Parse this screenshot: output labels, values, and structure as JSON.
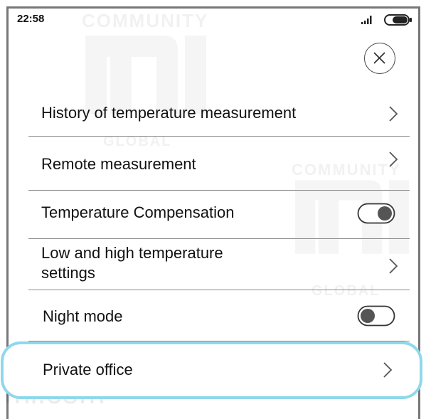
{
  "status_bar": {
    "time": "22:58",
    "signal_icon": "signal-bars-icon",
    "battery_icon": "battery-icon"
  },
  "header": {
    "close_icon": "close-circle-icon"
  },
  "menu": {
    "items": [
      {
        "label": "History of temperature measurement",
        "control": "chevron-right-icon"
      },
      {
        "label": "Remote measurement",
        "control": "chevron-right-icon"
      },
      {
        "label": "Temperature Compensation",
        "control": "toggle",
        "toggle_on": true
      },
      {
        "label": "Low and high temperature settings",
        "control": "chevron-right-icon"
      },
      {
        "label": "Night mode",
        "control": "toggle",
        "toggle_on": false
      },
      {
        "label": "Private office",
        "control": "chevron-right-icon",
        "highlighted": true
      }
    ]
  },
  "watermark": {
    "community": "COMMUNITY",
    "global": "GLOBAL",
    "site": "mi.com"
  },
  "colors": {
    "highlight_border": "#8fd8ec",
    "divider": "#8a8a8a",
    "frame": "#777777"
  }
}
